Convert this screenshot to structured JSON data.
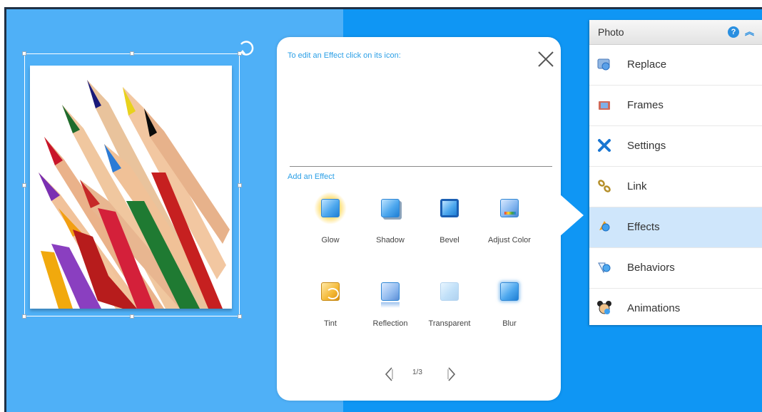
{
  "popup": {
    "hint": "To edit an Effect click on its icon:",
    "add_label": "Add an Effect",
    "effects": [
      "Glow",
      "Shadow",
      "Bevel",
      "Adjust Color",
      "Tint",
      "Reflection",
      "Transparent",
      "Blur"
    ],
    "page_indicator": "1/3"
  },
  "panel": {
    "title": "Photo",
    "items": [
      "Replace",
      "Frames",
      "Settings",
      "Link",
      "Effects",
      "Behaviors",
      "Animations"
    ],
    "active_item": "Effects"
  },
  "colors": {
    "accent": "#2b9fe6",
    "canvas_bg": "#0f96f4",
    "canvas_left": "#4fb0f7",
    "active_row": "#cfe6fb"
  },
  "icons": {
    "rotate": "rotate-icon",
    "close": "close-icon",
    "prev": "chevron-left-icon",
    "next": "chevron-right-icon",
    "help": "help-icon",
    "collapse": "collapse-icon"
  }
}
